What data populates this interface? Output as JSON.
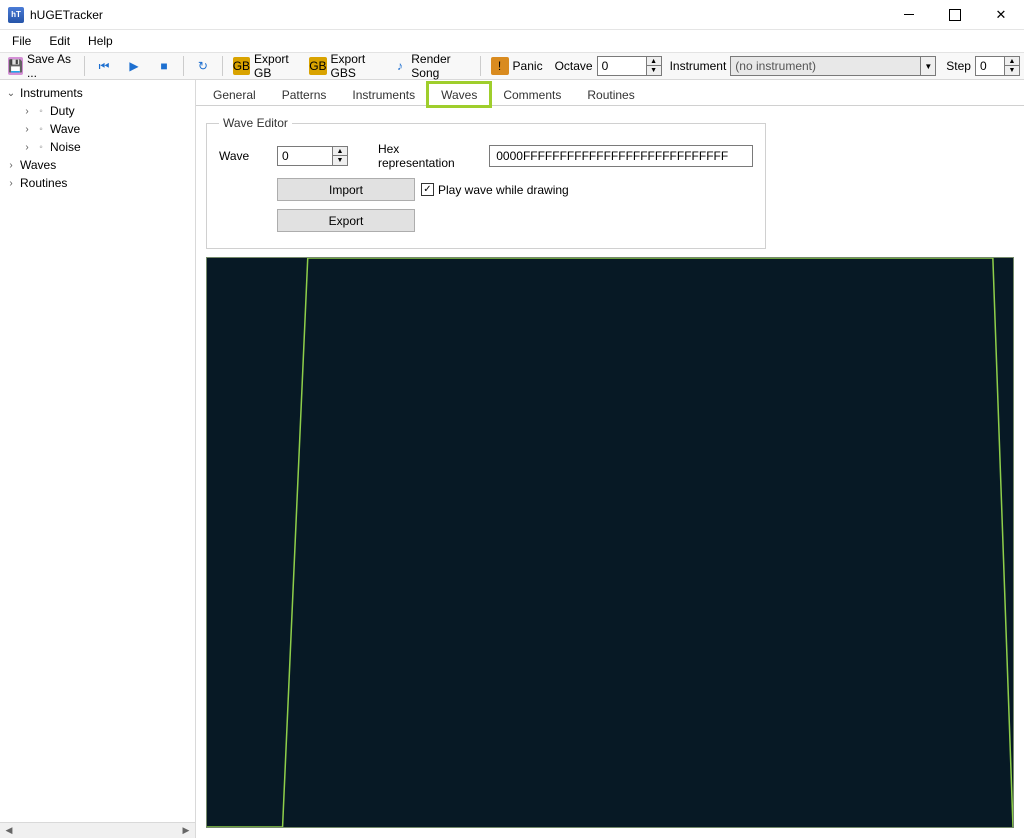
{
  "titlebar": {
    "title": "hUGETracker",
    "app_icon_label": "hT"
  },
  "menubar": {
    "items": [
      "File",
      "Edit",
      "Help"
    ]
  },
  "toolbar": {
    "save_as": "Save As ...",
    "export_gb": "Export GB",
    "export_gbs": "Export GBS",
    "render_song": "Render Song",
    "panic": "Panic",
    "octave_label": "Octave",
    "octave_value": "0",
    "instrument_label": "Instrument",
    "instrument_value": "(no instrument)",
    "step_label": "Step",
    "step_value": "0"
  },
  "sidebar": {
    "tree": [
      {
        "label": "Instruments",
        "twisty": "v",
        "indent": 0
      },
      {
        "label": "Duty",
        "twisty": ">",
        "dot": true,
        "indent": 1
      },
      {
        "label": "Wave",
        "twisty": ">",
        "dot": true,
        "indent": 1
      },
      {
        "label": "Noise",
        "twisty": ">",
        "dot": true,
        "indent": 1
      },
      {
        "label": "Waves",
        "twisty": ">",
        "indent": 0
      },
      {
        "label": "Routines",
        "twisty": ">",
        "indent": 0
      }
    ]
  },
  "tabs": {
    "items": [
      "General",
      "Patterns",
      "Instruments",
      "Waves",
      "Comments",
      "Routines"
    ],
    "active": "Waves",
    "highlighted": "Waves"
  },
  "editor": {
    "legend": "Wave Editor",
    "wave_label": "Wave",
    "wave_value": "0",
    "hex_label": "Hex representation",
    "hex_value": "0000FFFFFFFFFFFFFFFFFFFFFFFFFFFF",
    "import_label": "Import",
    "export_label": "Export",
    "play_label": "Play wave while drawing",
    "play_checked": true
  }
}
